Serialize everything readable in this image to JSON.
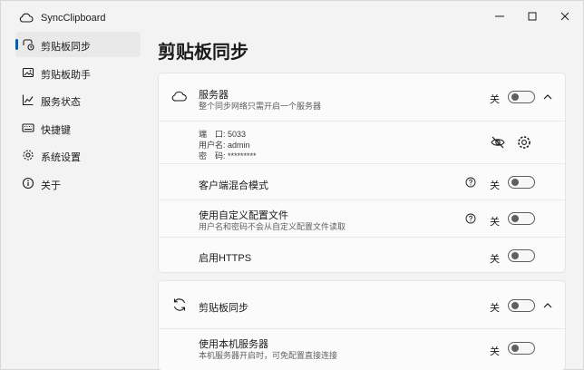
{
  "app": {
    "title": "SyncClipboard"
  },
  "sidebar": {
    "items": [
      {
        "label": "剪贴板同步",
        "icon": "clipboard-sync-icon",
        "active": true
      },
      {
        "label": "剪贴板助手",
        "icon": "image-icon"
      },
      {
        "label": "服务状态",
        "icon": "chart-icon"
      },
      {
        "label": "快捷键",
        "icon": "keyboard-icon"
      },
      {
        "label": "系统设置",
        "icon": "gear-icon"
      },
      {
        "label": "关于",
        "icon": "info-icon"
      }
    ]
  },
  "main": {
    "title": "剪贴板同步",
    "server_card": {
      "title": "服务器",
      "subtitle": "整个同步网络只需开启一个服务器",
      "toggle_label": "关",
      "port_line": "端　口: 5033",
      "user_line": "用户名: admin",
      "password_line": "密　码: *********",
      "rows": [
        {
          "title": "客户端混合模式",
          "subtitle": "",
          "toggle_label": "关",
          "help": true
        },
        {
          "title": "使用自定义配置文件",
          "subtitle": "用户名和密码不会从自定义配置文件读取",
          "toggle_label": "关",
          "help": true
        },
        {
          "title": "启用HTTPS",
          "subtitle": "",
          "toggle_label": "关",
          "help": false
        }
      ]
    },
    "sync_card": {
      "title": "剪贴板同步",
      "toggle_label": "关",
      "rows": [
        {
          "title": "使用本机服务器",
          "subtitle": "本机服务器开启时，可免配置直接连接",
          "toggle_label": "关"
        }
      ]
    }
  },
  "colors": {
    "accent": "#005fb8",
    "background": "#f3f3f3",
    "card": "#fbfbfb"
  }
}
